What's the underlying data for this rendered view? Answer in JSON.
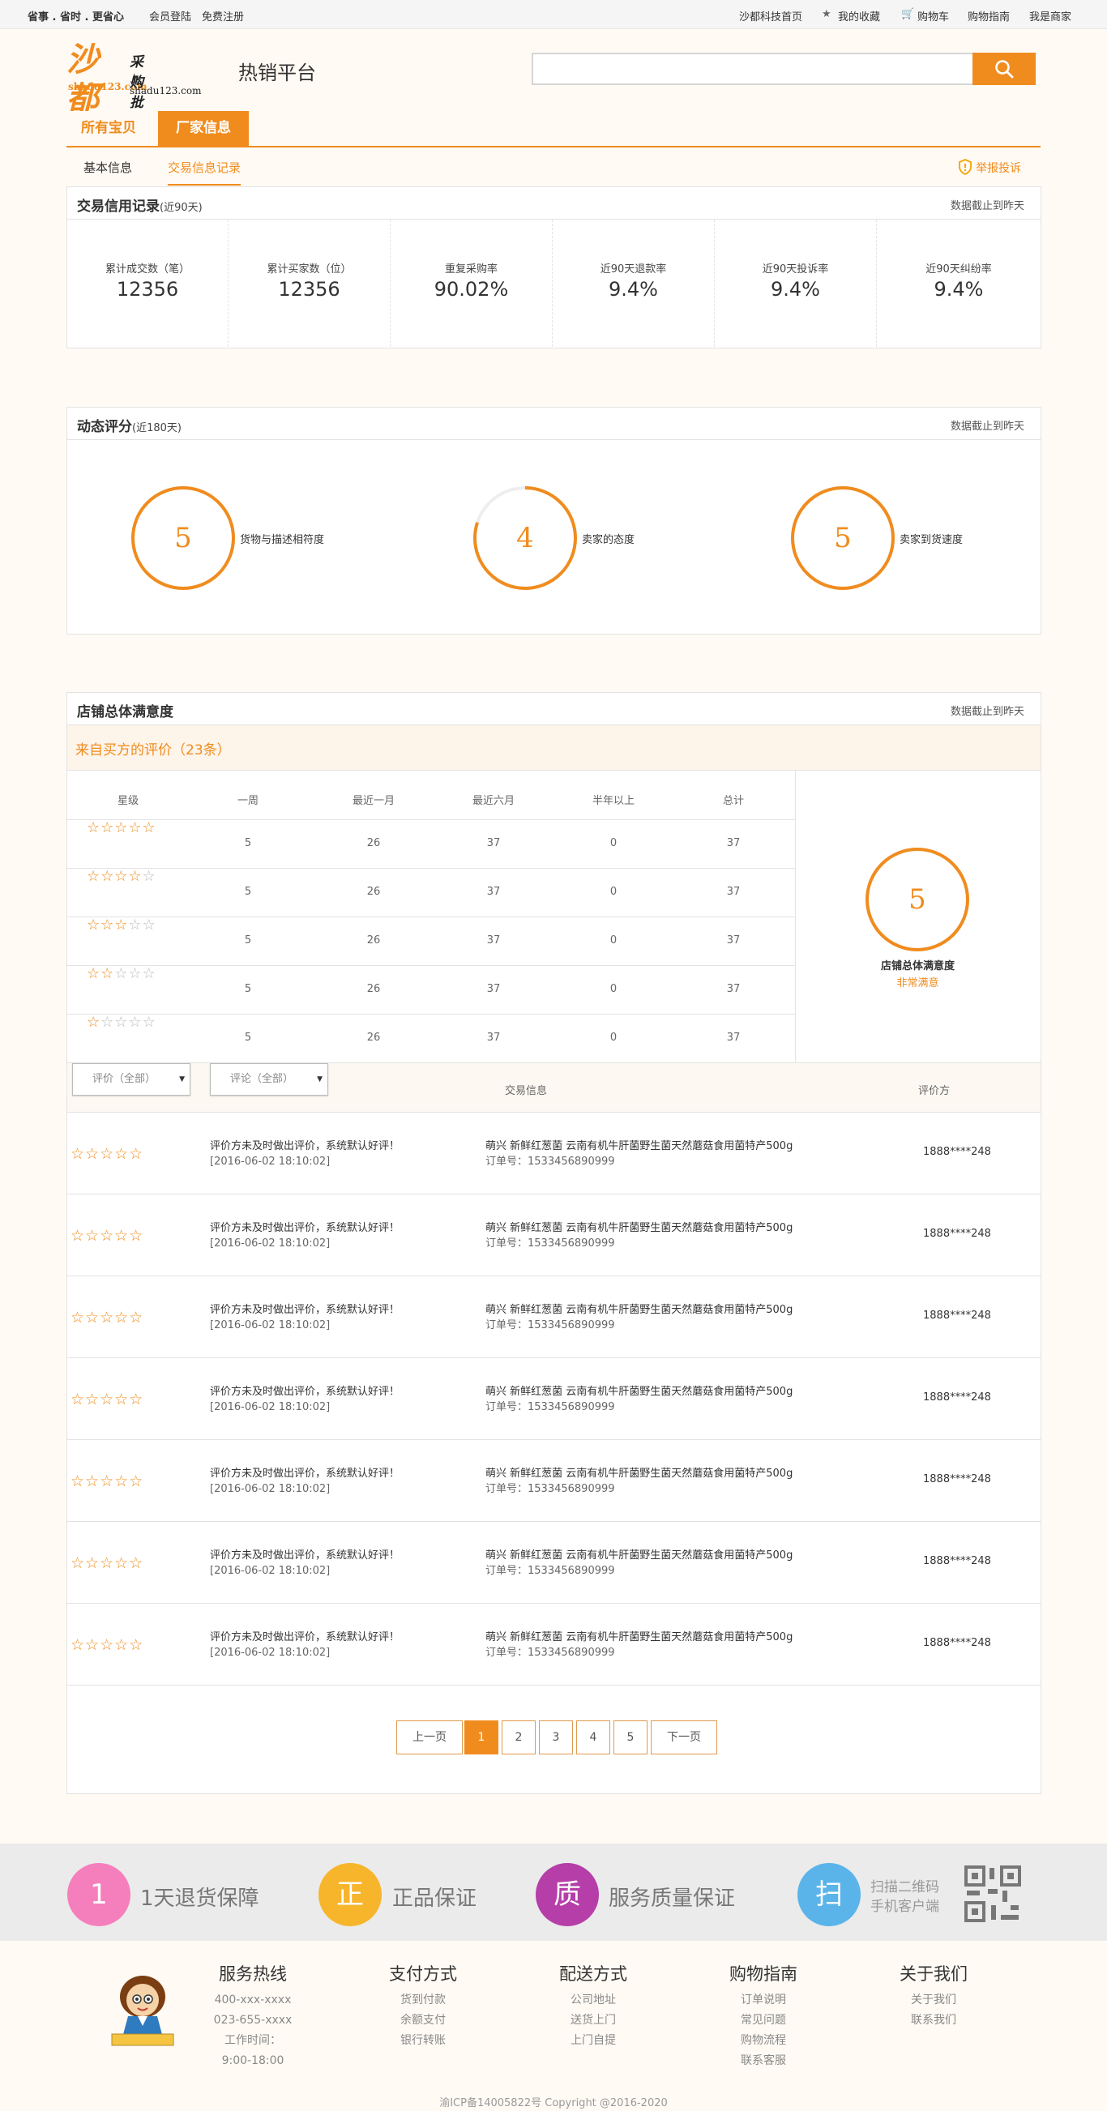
{
  "topbar": {
    "slogan": "省事 . 省时 . 更省心",
    "login": "会员登陆",
    "register": "免费注册",
    "home": "沙都科技首页",
    "favorites": "我的收藏",
    "cart": "购物车",
    "guide": "购物指南",
    "seller": "我是商家"
  },
  "logo": {
    "brand": "沙都",
    "brand_url": "shadu123.com",
    "caption": "采购批发",
    "caption_url": "上shadu123.com"
  },
  "header": {
    "site_name": "热销平台",
    "search_placeholder": ""
  },
  "tabs": [
    {
      "label": "所有宝贝"
    },
    {
      "label": "厂家信息"
    }
  ],
  "subtabs": [
    {
      "label": "基本信息"
    },
    {
      "label": "交易信息记录"
    }
  ],
  "report_label": "举报投诉",
  "credit": {
    "title": "交易信用记录",
    "period": "(近90天)",
    "note": "数据截止到昨天",
    "stats": [
      {
        "label": "累计成交数（笔）",
        "value": "12356"
      },
      {
        "label": "累计买家数（位）",
        "value": "12356"
      },
      {
        "label": "重复采购率",
        "value": "90.02%"
      },
      {
        "label": "近90天退款率",
        "value": "9.4%"
      },
      {
        "label": "近90天投诉率",
        "value": "9.4%"
      },
      {
        "label": "近90天纠纷率",
        "value": "9.4%"
      }
    ]
  },
  "dynamic": {
    "title": "动态评分",
    "period": "(近180天)",
    "note": "数据截止到昨天",
    "scores": [
      {
        "value": "5",
        "label": "货物与描述相符度",
        "fraction": 1.0
      },
      {
        "value": "4",
        "label": "卖家的态度",
        "fraction": 0.8
      },
      {
        "value": "5",
        "label": "卖家到货速度",
        "fraction": 1.0
      }
    ]
  },
  "satisfaction": {
    "title": "店铺总体满意度",
    "note": "数据截止到昨天",
    "from_buyers": "来自买方的评价（23条）",
    "columns": [
      "星级",
      "一周",
      "最近一月",
      "最近六月",
      "半年以上",
      "总计"
    ],
    "rows": [
      {
        "stars": 5,
        "week": "5",
        "month": "26",
        "six_month": "37",
        "older": "0",
        "total": "37"
      },
      {
        "stars": 4,
        "week": "5",
        "month": "26",
        "six_month": "37",
        "older": "0",
        "total": "37"
      },
      {
        "stars": 3,
        "week": "5",
        "month": "26",
        "six_month": "37",
        "older": "0",
        "total": "37"
      },
      {
        "stars": 2,
        "week": "5",
        "month": "26",
        "six_month": "37",
        "older": "0",
        "total": "37"
      },
      {
        "stars": 1,
        "week": "5",
        "month": "26",
        "six_month": "37",
        "older": "0",
        "total": "37"
      }
    ],
    "overall_value": "5",
    "overall_fraction": 1.0,
    "overall_label": "店铺总体满意度",
    "overall_level": "非常满意"
  },
  "reviews": {
    "filter_rating": "评价（全部）",
    "filter_comment": "评论（全部）",
    "col_trade": "交易信息",
    "col_reviewer": "评价方",
    "items": [
      {
        "stars": 5,
        "comment": "评价方未及时做出评价，系统默认好评！",
        "date": "[2016-06-02 18:10:02]",
        "product": "萌兴 新鲜红葱菌 云南有机牛肝菌野生菌天然蘑菇食用菌特产500g",
        "order": "订单号：1533456890999",
        "reviewer": "1888****248"
      },
      {
        "stars": 5,
        "comment": "评价方未及时做出评价，系统默认好评！",
        "date": "[2016-06-02 18:10:02]",
        "product": "萌兴 新鲜红葱菌 云南有机牛肝菌野生菌天然蘑菇食用菌特产500g",
        "order": "订单号：1533456890999",
        "reviewer": "1888****248"
      },
      {
        "stars": 5,
        "comment": "评价方未及时做出评价，系统默认好评！",
        "date": "[2016-06-02 18:10:02]",
        "product": "萌兴 新鲜红葱菌 云南有机牛肝菌野生菌天然蘑菇食用菌特产500g",
        "order": "订单号：1533456890999",
        "reviewer": "1888****248"
      },
      {
        "stars": 5,
        "comment": "评价方未及时做出评价，系统默认好评！",
        "date": "[2016-06-02 18:10:02]",
        "product": "萌兴 新鲜红葱菌 云南有机牛肝菌野生菌天然蘑菇食用菌特产500g",
        "order": "订单号：1533456890999",
        "reviewer": "1888****248"
      },
      {
        "stars": 5,
        "comment": "评价方未及时做出评价，系统默认好评！",
        "date": "[2016-06-02 18:10:02]",
        "product": "萌兴 新鲜红葱菌 云南有机牛肝菌野生菌天然蘑菇食用菌特产500g",
        "order": "订单号：1533456890999",
        "reviewer": "1888****248"
      },
      {
        "stars": 5,
        "comment": "评价方未及时做出评价，系统默认好评！",
        "date": "[2016-06-02 18:10:02]",
        "product": "萌兴 新鲜红葱菌 云南有机牛肝菌野生菌天然蘑菇食用菌特产500g",
        "order": "订单号：1533456890999",
        "reviewer": "1888****248"
      },
      {
        "stars": 5,
        "comment": "评价方未及时做出评价，系统默认好评！",
        "date": "[2016-06-02 18:10:02]",
        "product": "萌兴 新鲜红葱菌 云南有机牛肝菌野生菌天然蘑菇食用菌特产500g",
        "order": "订单号：1533456890999",
        "reviewer": "1888****248"
      }
    ]
  },
  "pagination": {
    "prev": "上一页",
    "pages": [
      "1",
      "2",
      "3",
      "4",
      "5"
    ],
    "current": "1",
    "next": "下一页"
  },
  "guarantees": [
    {
      "glyph": "1",
      "label": "1天退货保障",
      "color": "#f57fbd"
    },
    {
      "glyph": "正",
      "label": "正品保证",
      "color": "#f7b52c"
    },
    {
      "glyph": "质",
      "label": "服务质量保证",
      "color": "#b53ea8"
    },
    {
      "glyph": "扫",
      "label": "",
      "color": "#5ab4ea"
    }
  ],
  "qr_text": {
    "line1": "扫描二维码",
    "line2": "手机客户端"
  },
  "footer": {
    "columns": [
      {
        "title": "服务热线",
        "items": [
          "400-xxx-xxxx",
          "023-655-xxxx",
          "工作时间：",
          "9:00-18:00"
        ]
      },
      {
        "title": "支付方式",
        "items": [
          "货到付款",
          "余额支付",
          "银行转账"
        ]
      },
      {
        "title": "配送方式",
        "items": [
          "公司地址",
          "送货上门",
          "上门自提"
        ]
      },
      {
        "title": "购物指南",
        "items": [
          "订单说明",
          "常见问题",
          "购物流程",
          "联系客服"
        ]
      },
      {
        "title": "关于我们",
        "items": [
          "关于我们",
          "联系我们"
        ]
      }
    ],
    "copyright": "渝ICP备14005822号 Copyright @2016-2020"
  },
  "colors": {
    "accent": "#f08c1e",
    "panel_border": "#e3e3e3",
    "background": "#fffaf4"
  }
}
